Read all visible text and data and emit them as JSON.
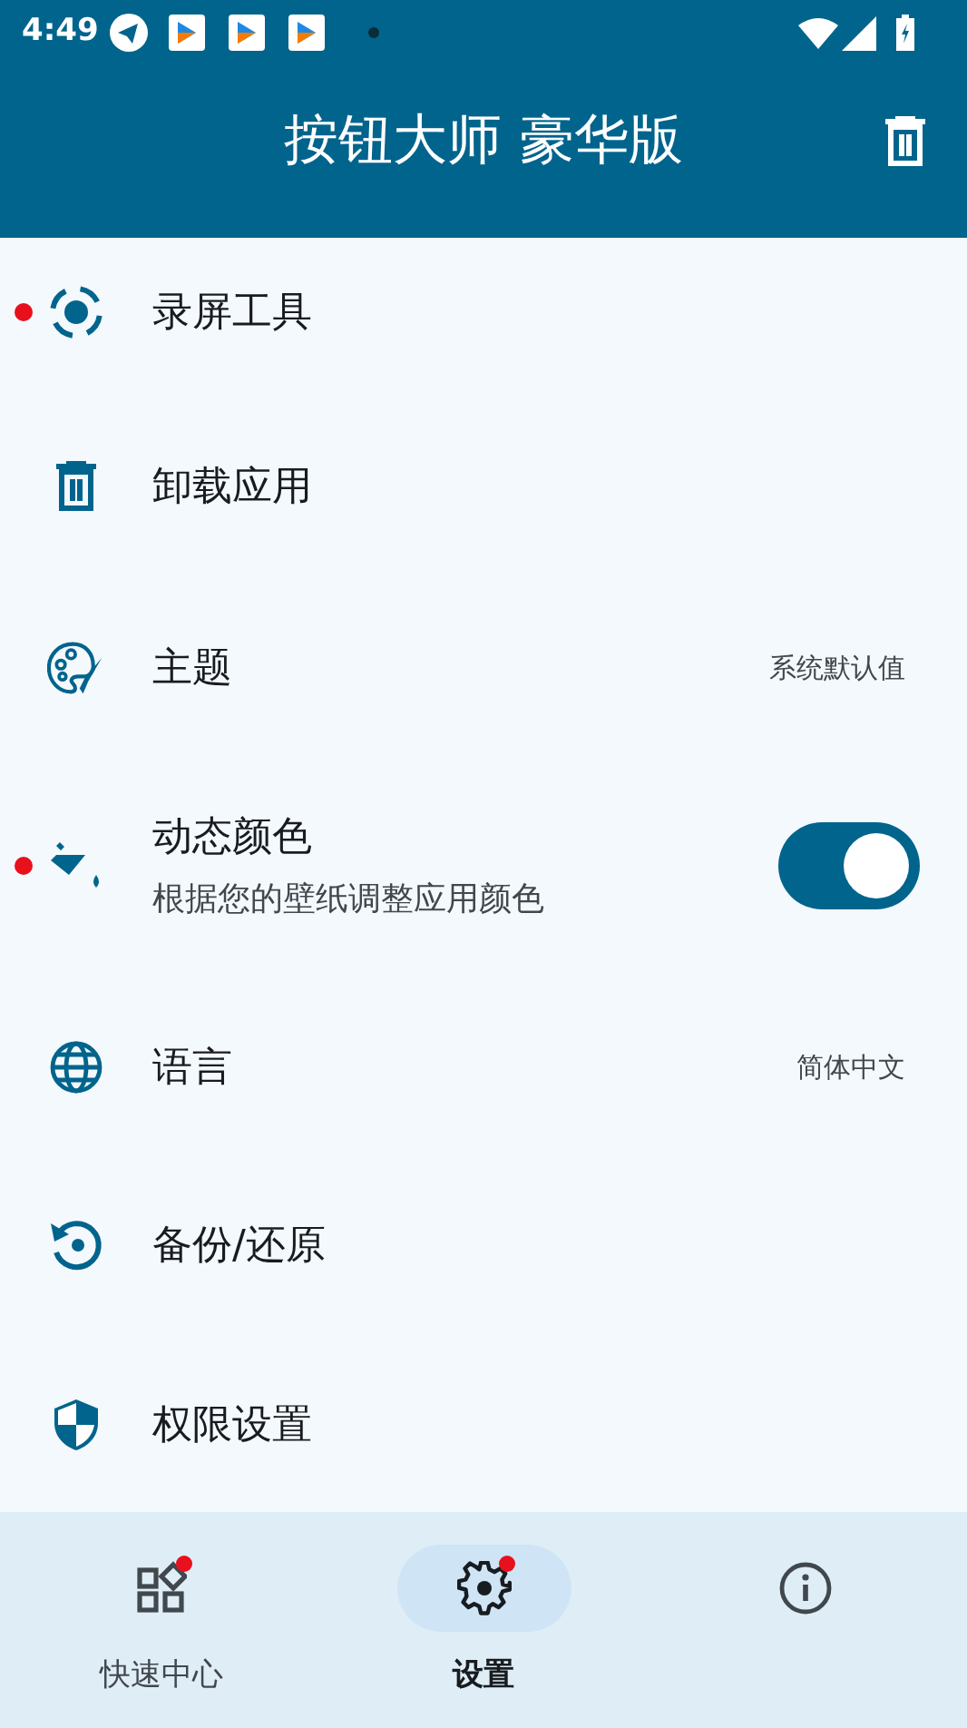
{
  "status_bar": {
    "time": "4:49"
  },
  "app_bar": {
    "title": "按钮大师 豪华版"
  },
  "settings": [
    {
      "kind": "record",
      "label": "录屏工具",
      "badge": true
    },
    {
      "kind": "uninstall",
      "label": "卸载应用",
      "badge": false
    },
    {
      "kind": "theme",
      "label": "主题",
      "value": "系统默认值",
      "badge": false
    },
    {
      "kind": "dynamic",
      "label": "动态颜色",
      "subtitle": "根据您的壁纸调整应用颜色",
      "badge": true,
      "on": true
    },
    {
      "kind": "language",
      "label": "语言",
      "value": "简体中文",
      "badge": false
    },
    {
      "kind": "backup",
      "label": "备份/还原",
      "badge": false
    },
    {
      "kind": "permission",
      "label": "权限设置",
      "badge": false
    }
  ],
  "bottom_nav": [
    {
      "kind": "quick",
      "label": "快速中心",
      "selected": false,
      "badge": true
    },
    {
      "kind": "settings",
      "label": "设置",
      "selected": true,
      "badge": true
    },
    {
      "kind": "about",
      "selected": false,
      "badge": false
    }
  ]
}
